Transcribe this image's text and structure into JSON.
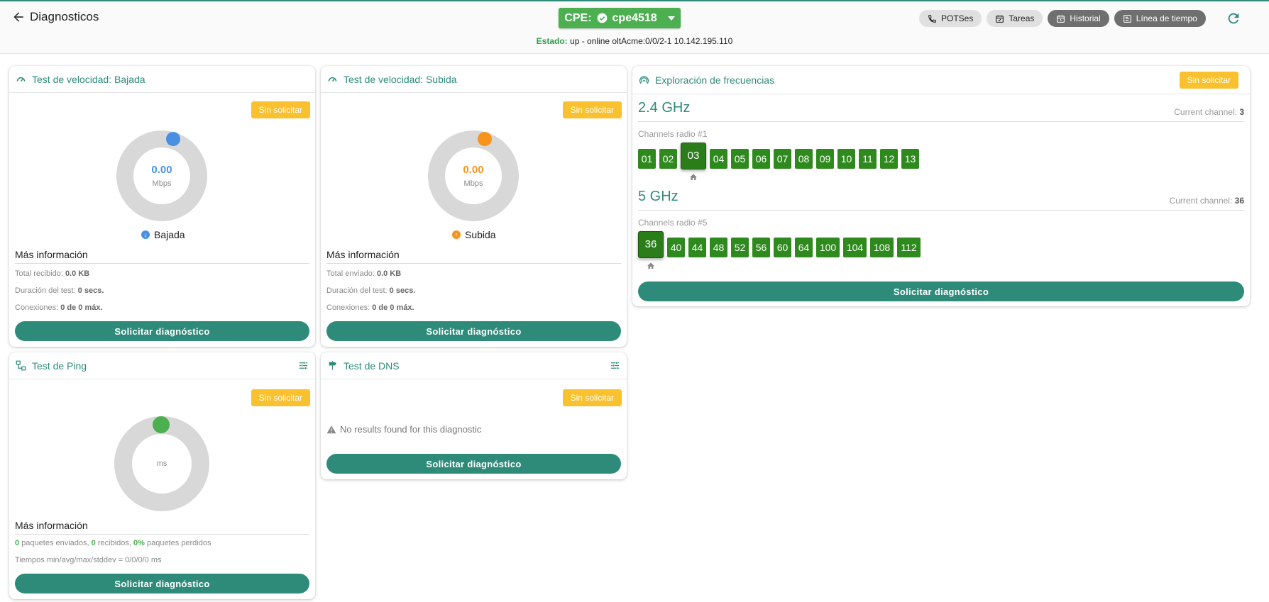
{
  "header": {
    "back_label": "Diagnosticos",
    "cpe_prefix": "CPE:",
    "cpe_name": "cpe4518",
    "estado_label": "Estado:",
    "estado_value": "up - online oltAcme:0/0/2-1 10.142.195.110",
    "chips": {
      "potses": "POTSes",
      "tareas": "Tareas",
      "historial": "Historial",
      "linea": "Línea de tiempo"
    }
  },
  "common": {
    "sin_solicitar": "Sin solicitar",
    "solicitar": "Solicitar diagnóstico",
    "mas_info": "Más información"
  },
  "bajada": {
    "title": "Test de velocidad: Bajada",
    "value": "0.00",
    "unit": "Mbps",
    "legend": "Bajada",
    "color": "#4a90e2",
    "info": [
      {
        "label": "Total recibido:",
        "value": "0.0 KB"
      },
      {
        "label": "Duración del test:",
        "value": "0 secs."
      },
      {
        "label": "Conexiones:",
        "value": "0 de 0 máx."
      }
    ]
  },
  "subida": {
    "title": "Test de velocidad: Subida",
    "value": "0.00",
    "unit": "Mbps",
    "legend": "Subida",
    "color": "#f7941d",
    "info": [
      {
        "label": "Total enviado:",
        "value": "0.0 KB"
      },
      {
        "label": "Duración del test:",
        "value": "0 secs."
      },
      {
        "label": "Conexiones:",
        "value": "0 de 0 máx."
      }
    ]
  },
  "ping": {
    "title": "Test de Ping",
    "unit": "ms",
    "color": "#4caf50",
    "stats": {
      "enviados": "0",
      "enviados_label": "paquetes enviados,",
      "recibidos": "0",
      "recibidos_label": "recibidos,",
      "perdidos": "0%",
      "perdidos_label": "paquetes perdidos"
    },
    "tiempos": "Tiempos min/avg/max/stddev = 0/0/0/0 ms"
  },
  "dns": {
    "title": "Test de DNS",
    "no_results": "No results found for this diagnostic"
  },
  "freq": {
    "title": "Exploración de frecuencias",
    "current_label": "Current channel:",
    "band24": {
      "name": "2.4 GHz",
      "current": "3",
      "radio": "Channels radio #1",
      "channels": [
        "01",
        "02",
        "03",
        "04",
        "05",
        "06",
        "07",
        "08",
        "09",
        "10",
        "11",
        "12",
        "13"
      ],
      "selected": "03"
    },
    "band5": {
      "name": "5 GHz",
      "current": "36",
      "radio": "Channels radio #5",
      "channels": [
        "36",
        "40",
        "44",
        "48",
        "52",
        "56",
        "60",
        "64",
        "100",
        "104",
        "108",
        "112"
      ],
      "selected": "36"
    }
  }
}
